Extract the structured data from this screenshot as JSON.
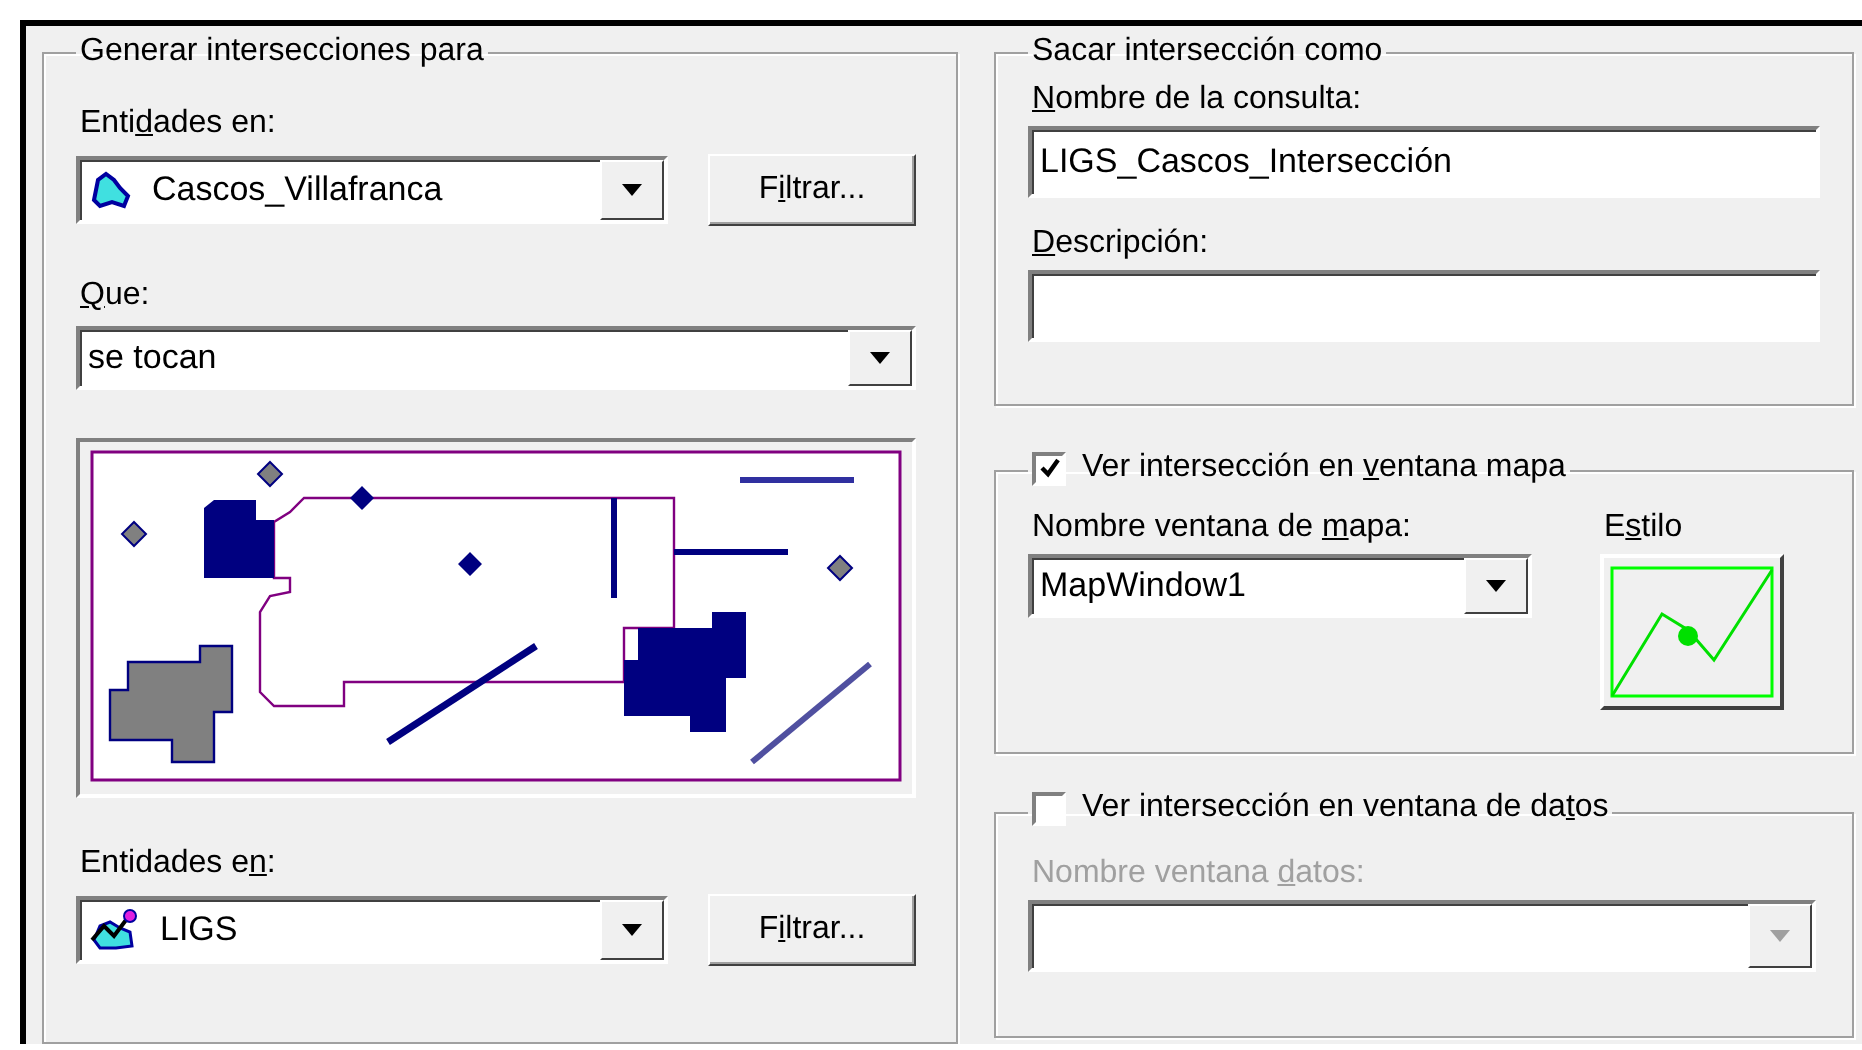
{
  "left_group": {
    "title": "Generar intersecciones para",
    "source_label": {
      "before": "Enti",
      "key": "d",
      "after": "ades en:"
    },
    "source_layer": {
      "value": "Cascos_Villafranca",
      "kind": "region"
    },
    "source_filter_button": {
      "before": "F",
      "key": "i",
      "after": "ltrar..."
    },
    "relation_label": {
      "key": "Q",
      "after": "ue:"
    },
    "relation": {
      "value": "se tocan"
    },
    "target_label": {
      "before": "Entidades e",
      "key": "n",
      "after": ":"
    },
    "target_layer": {
      "value": "LIGS",
      "kind": "mixed"
    },
    "target_filter_button": {
      "before": "F",
      "key": "i",
      "after": "ltrar..."
    }
  },
  "output_group": {
    "title": "Sacar intersección como",
    "name_label": {
      "key": "N",
      "after": "ombre de la consulta:"
    },
    "name_value": "LIGS_Cascos_Intersección",
    "description_label": {
      "key": "D",
      "after": "escripción:"
    }
  },
  "map_window_group": {
    "checked": true,
    "title": {
      "before": "Ver intersección en ",
      "key": "v",
      "after": "entana mapa"
    },
    "window_label": {
      "before": "Nombre ventana de ",
      "key": "m",
      "after": "apa:"
    },
    "window": {
      "value": "MapWindow1"
    },
    "style_label": {
      "before": "E",
      "key": "s",
      "after": "tilo"
    }
  },
  "data_window_group": {
    "checked": false,
    "disabled": true,
    "title": {
      "before": "Ver intersección en ventana de da",
      "key": "t",
      "after": "os"
    },
    "window_label": {
      "before": "Nombre ventana ",
      "key": "d",
      "after": "atos:"
    }
  }
}
